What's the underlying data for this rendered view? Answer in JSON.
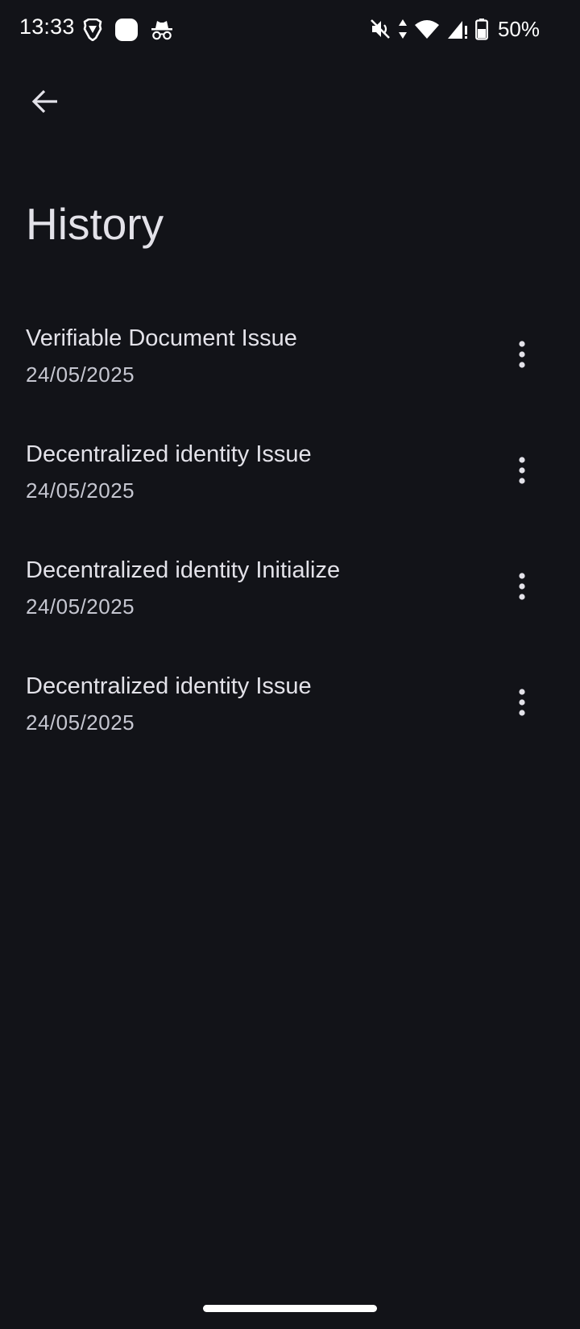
{
  "status_bar": {
    "time": "13:33",
    "battery": "50%",
    "icons_left": [
      "brave-shield-icon",
      "app-square-icon",
      "incognito-icon"
    ],
    "icons_right": [
      "mute-icon",
      "data-arrows-icon",
      "wifi-icon",
      "signal-icon",
      "battery-icon"
    ]
  },
  "header": {
    "back_icon": "arrow-back-icon",
    "title": "History"
  },
  "history": {
    "items": [
      {
        "title": "Verifiable Document Issue",
        "date": "24/05/2025"
      },
      {
        "title": "Decentralized identity Issue",
        "date": "24/05/2025"
      },
      {
        "title": "Decentralized identity Initialize",
        "date": "24/05/2025"
      },
      {
        "title": "Decentralized identity Issue",
        "date": "24/05/2025"
      }
    ],
    "more_icon": "more-vert-icon"
  },
  "colors": {
    "background": "#121318",
    "text_primary": "#e3e2e9",
    "text_secondary": "#c5c6d0"
  }
}
